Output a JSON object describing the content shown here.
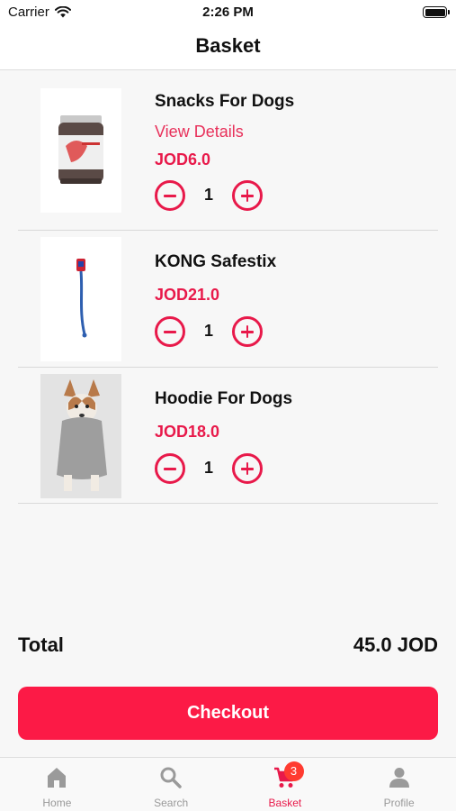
{
  "status_bar": {
    "carrier": "Carrier",
    "time": "2:26 PM"
  },
  "header": {
    "title": "Basket"
  },
  "basket": {
    "items": [
      {
        "name": "Snacks For Dogs",
        "link": "View Details",
        "price": "JOD6.0",
        "quantity": "1"
      },
      {
        "name": "KONG Safestix",
        "price": "JOD21.0",
        "quantity": "1"
      },
      {
        "name": "Hoodie For Dogs",
        "price": "JOD18.0",
        "quantity": "1"
      }
    ]
  },
  "summary": {
    "total_label": "Total",
    "total_value": "45.0 JOD"
  },
  "checkout": {
    "label": "Checkout"
  },
  "tabs": {
    "items": [
      {
        "label": "Home",
        "icon": "home-icon"
      },
      {
        "label": "Search",
        "icon": "search-icon"
      },
      {
        "label": "Basket",
        "icon": "cart-icon",
        "badge": "3",
        "active": true
      },
      {
        "label": "Profile",
        "icon": "person-icon"
      }
    ]
  },
  "colors": {
    "accent": "#e8194a",
    "checkout_button": "#fc1a46",
    "badge": "#ff3b30",
    "inactive_tab": "#999999"
  }
}
